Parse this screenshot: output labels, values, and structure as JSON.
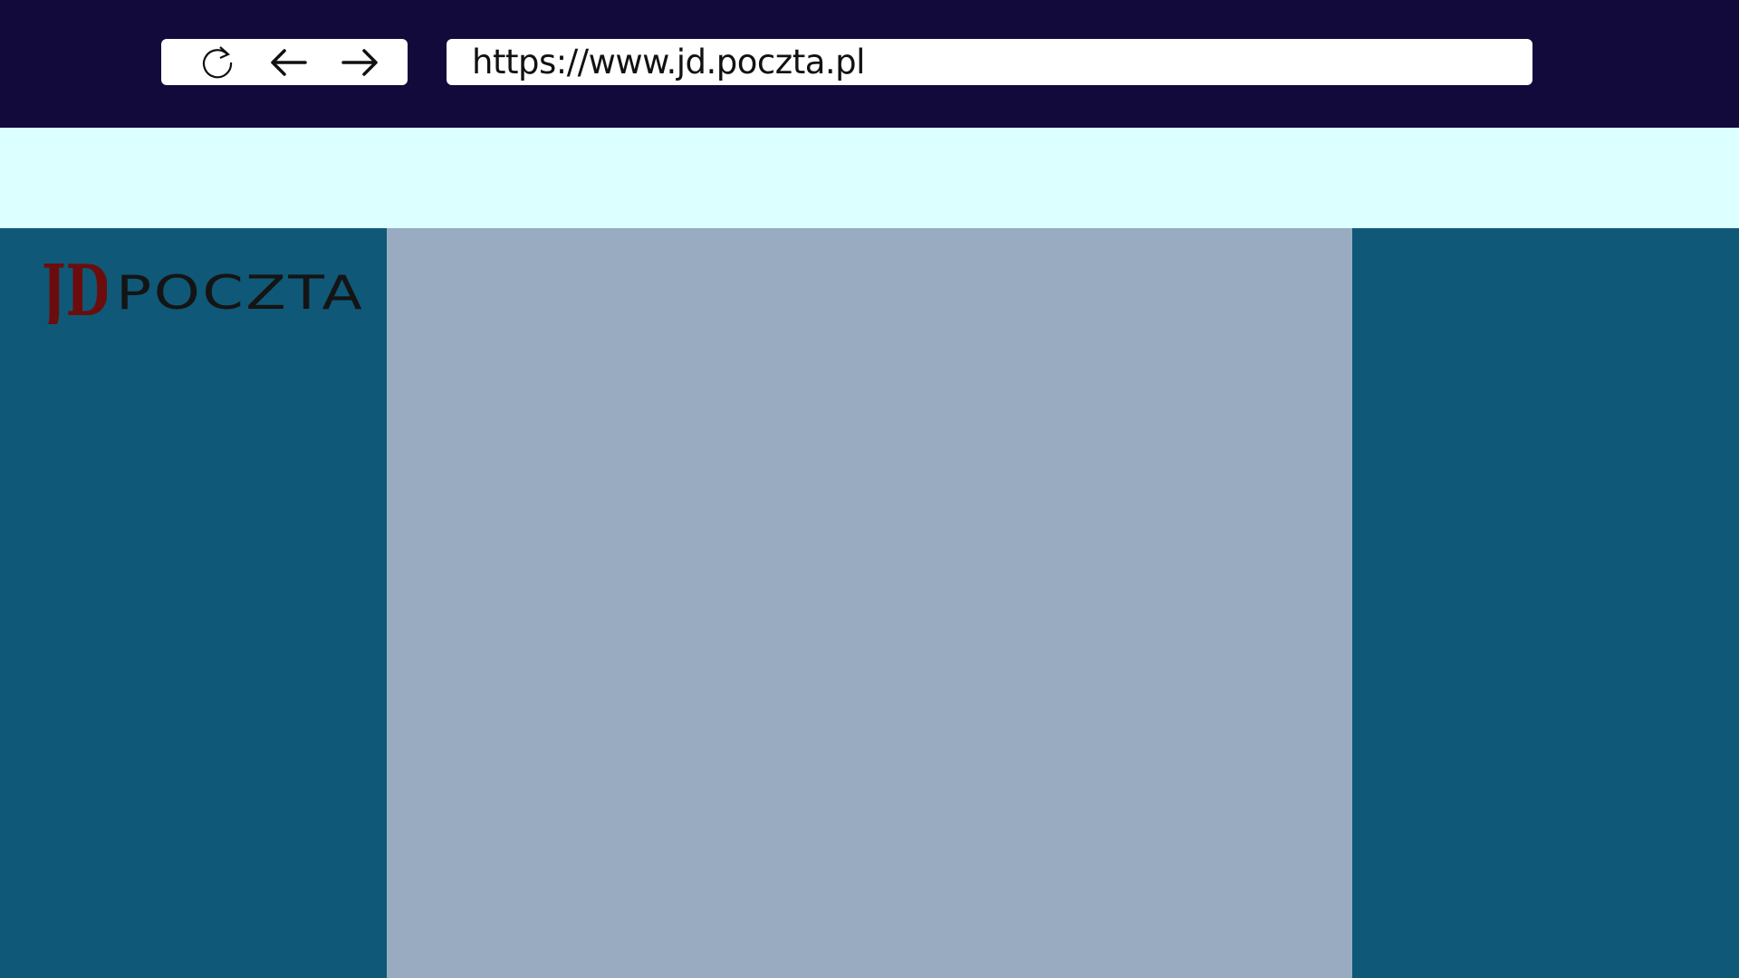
{
  "browser": {
    "url": "https://www.jd.poczta.pl",
    "nav_icons": [
      "reload-icon",
      "back-arrow-icon",
      "forward-arrow-icon"
    ]
  },
  "logo": {
    "mark": "JD",
    "text": "POCZTA"
  },
  "colors": {
    "browser_bar": "#120a3b",
    "subheader": "#dcffff",
    "side_columns": "#105877",
    "main_column": "#98abc1",
    "logo_mark": "#6b0d0d",
    "logo_text": "#141414"
  }
}
